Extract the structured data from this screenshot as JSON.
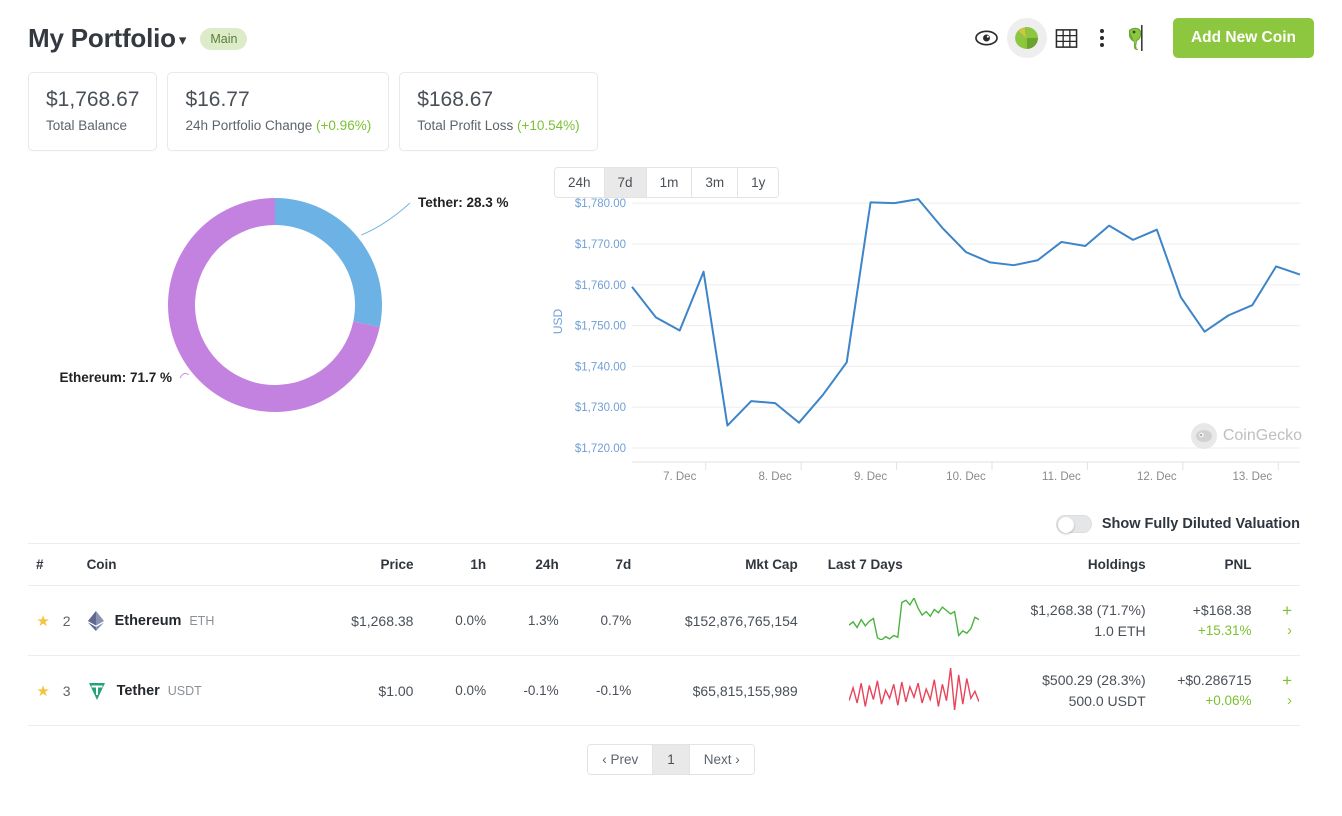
{
  "header": {
    "title": "My Portfolio",
    "chevron_icon": "chevron-down-icon",
    "badge": "Main",
    "icons": [
      {
        "name": "eye-icon",
        "label": "eye"
      },
      {
        "name": "pie-chart-icon",
        "label": "pie chart"
      },
      {
        "name": "table-grid-icon",
        "label": "table"
      },
      {
        "name": "more-vertical-icon",
        "label": "more"
      },
      {
        "name": "gecko-mascot-icon",
        "label": "gecko"
      }
    ],
    "add_button": "Add New Coin",
    "accent_green": "#8dc63f"
  },
  "stats": [
    {
      "value": "$1,768.67",
      "label": "Total Balance",
      "change": ""
    },
    {
      "value": "$16.77",
      "label": "24h Portfolio Change",
      "change": "(+0.96%)"
    },
    {
      "value": "$168.67",
      "label": "Total Profit Loss",
      "change": "(+10.54%)"
    }
  ],
  "range_tabs": [
    {
      "label": "24h",
      "selected": false
    },
    {
      "label": "7d",
      "selected": true
    },
    {
      "label": "1m",
      "selected": false
    },
    {
      "label": "3m",
      "selected": false
    },
    {
      "label": "1y",
      "selected": false
    }
  ],
  "watermark": "CoinGecko",
  "toggle": {
    "label": "Show Fully Diluted Valuation",
    "state": "off"
  },
  "table": {
    "headers": [
      "#",
      "Coin",
      "Price",
      "1h",
      "24h",
      "7d",
      "Mkt Cap",
      "Last 7 Days",
      "Holdings",
      "PNL"
    ],
    "rows": [
      {
        "star": "★",
        "rank": "2",
        "coin_name": "Ethereum",
        "coin_symbol": "ETH",
        "coin_color": "#8a92b2",
        "price": "$1,268.38",
        "ch_1h": "0.0%",
        "ch_1h_dir": "pos",
        "ch_24h": "1.3%",
        "ch_24h_dir": "pos",
        "ch_7d": "0.7%",
        "ch_7d_dir": "pos",
        "mkt_cap": "$152,876,765,154",
        "spark_color": "#4ab33e",
        "holdings_value": "$1,268.38 (71.7%)",
        "holdings_amount": "1.0 ETH",
        "pnl_value": "+$168.38",
        "pnl_pct": "+15.31%",
        "add_icon": "plus-icon",
        "expand_icon": "chevron-right-icon"
      },
      {
        "star": "★",
        "rank": "3",
        "coin_name": "Tether",
        "coin_symbol": "USDT",
        "coin_color": "#26a17b",
        "price": "$1.00",
        "ch_1h": "0.0%",
        "ch_1h_dir": "pos",
        "ch_24h": "-0.1%",
        "ch_24h_dir": "neg",
        "ch_7d": "-0.1%",
        "ch_7d_dir": "neg",
        "mkt_cap": "$65,815,155,989",
        "spark_color": "#e8445a",
        "holdings_value": "$500.29 (28.3%)",
        "holdings_amount": "500.0 USDT",
        "pnl_value": "+$0.286715",
        "pnl_pct": "+0.06%",
        "add_icon": "plus-icon",
        "expand_icon": "chevron-right-icon"
      }
    ]
  },
  "pagination": {
    "prev": "‹ Prev",
    "current": "1",
    "next": "Next ›"
  },
  "chart_data": [
    {
      "type": "pie",
      "title": "",
      "donut": true,
      "slices": [
        {
          "name": "Tether",
          "value": 28.3,
          "label": "Tether: 28.3 %",
          "color": "#6cb2e4"
        },
        {
          "name": "Ethereum",
          "value": 71.7,
          "label": "Ethereum: 71.7 %",
          "color": "#c382e0"
        }
      ],
      "legend_position": "callout-labels"
    },
    {
      "type": "line",
      "title": "",
      "ylabel": "USD",
      "xlabel": "",
      "ylim": [
        1720,
        1782
      ],
      "yticks": [
        "$1,720.00",
        "$1,730.00",
        "$1,740.00",
        "$1,750.00",
        "$1,760.00",
        "$1,770.00",
        "$1,780.00"
      ],
      "xticks": [
        "7. Dec",
        "8. Dec",
        "9. Dec",
        "10. Dec",
        "11. Dec",
        "12. Dec",
        "13. Dec"
      ],
      "grid": true,
      "line_color": "#3d85c8",
      "x": [
        0,
        1,
        2,
        3,
        4,
        5,
        6,
        7,
        8,
        9,
        10,
        11,
        12,
        13,
        14,
        15,
        16,
        17,
        18,
        19,
        20,
        21,
        22,
        23,
        24,
        25,
        26,
        27,
        28
      ],
      "values": [
        1759.5,
        1752.0,
        1748.8,
        1763.2,
        1725.5,
        1731.5,
        1731.0,
        1726.2,
        1733.0,
        1741.0,
        1780.2,
        1780.0,
        1781.0,
        1774.0,
        1768.0,
        1765.5,
        1764.8,
        1766.0,
        1770.5,
        1769.5,
        1774.5,
        1771.0,
        1773.5,
        1757.0,
        1748.5,
        1752.5,
        1755.0,
        1764.5,
        1762.5
      ]
    },
    {
      "type": "line",
      "name": "Ethereum 7-day sparkline",
      "line_color": "#4ab33e",
      "values": [
        48,
        54,
        44,
        58,
        47,
        55,
        60,
        26,
        22,
        28,
        24,
        30,
        27,
        88,
        92,
        84,
        96,
        78,
        66,
        72,
        64,
        76,
        70,
        80,
        74,
        68,
        72,
        30,
        38,
        34,
        42,
        62,
        58
      ]
    },
    {
      "type": "line",
      "name": "Tether 7-day sparkline",
      "line_color": "#e8445a",
      "values": [
        40,
        62,
        36,
        70,
        30,
        66,
        42,
        74,
        34,
        58,
        44,
        68,
        32,
        72,
        38,
        64,
        46,
        70,
        36,
        60,
        42,
        76,
        30,
        68,
        40,
        96,
        24,
        84,
        34,
        78,
        44,
        56,
        38
      ]
    }
  ]
}
